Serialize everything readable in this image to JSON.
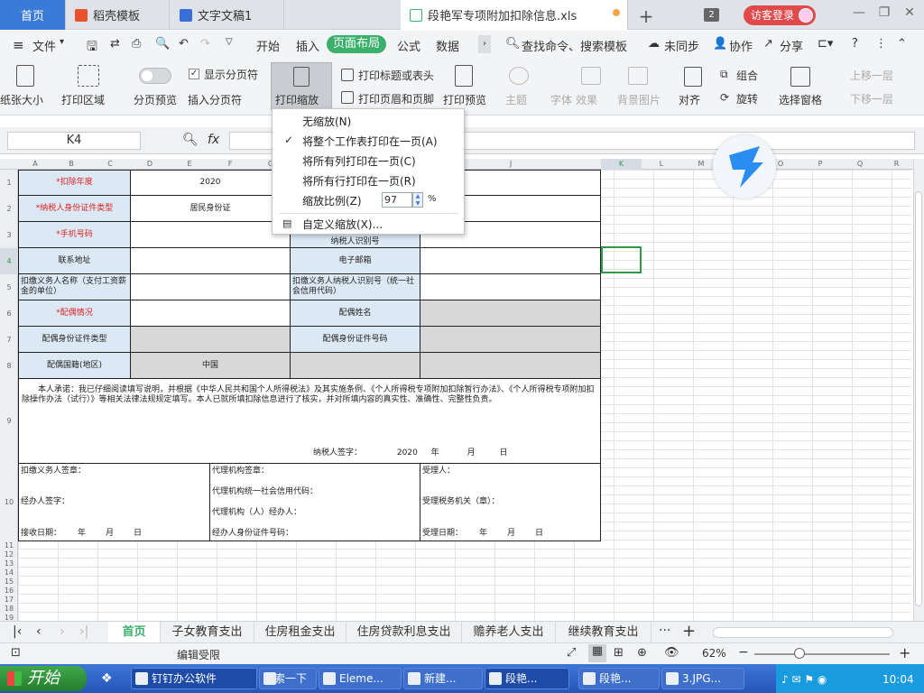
{
  "tabs": {
    "home": "首页",
    "t1": "稻壳模板",
    "t2": "文字文稿1",
    "t3": "段艳军专项附加扣除信息.xls",
    "count": "2",
    "login": "访客登录"
  },
  "menu": {
    "file": "文件",
    "items": [
      "开始",
      "插入",
      "页面布局",
      "公式",
      "数据"
    ],
    "search": "查找命令、搜索模板",
    "unsync": "未同步",
    "collab": "协作",
    "share": "分享"
  },
  "ribbon": {
    "paper_size": "纸张大小",
    "print_area": "打印区域",
    "show_pagebreak": "显示分页符",
    "pagebreak_preview": "分页预览",
    "insert_pagebreak": "插入分页符",
    "print_scale": "打印缩放",
    "print_titles": "打印标题或表头",
    "print_headerfooter": "打印页眉和页脚",
    "print_preview": "打印预览",
    "theme": "主题",
    "font": "字体",
    "effects": "效果",
    "background": "背景图片",
    "align": "对齐",
    "group": "组合",
    "rotate": "旋转",
    "select_pane": "选择窗格",
    "bring_forward": "上移一层",
    "send_backward": "下移一层"
  },
  "formula": {
    "cell_ref": "K4",
    "fx": "fx"
  },
  "dropdown": {
    "no_scale": "无缩放(N)",
    "fit_sheet": "将整个工作表打印在一页(A)",
    "fit_cols": "将所有列打印在一页(C)",
    "fit_rows": "将所有行打印在一页(R)",
    "scale_label": "缩放比例(Z)",
    "scale_value": "97",
    "percent": "%",
    "custom": "自定义缩放(X)..."
  },
  "columns": [
    "A",
    "B",
    "C",
    "D",
    "E",
    "F",
    "G",
    "H",
    "I",
    "J",
    "K",
    "L",
    "M",
    "N",
    "O",
    "P",
    "Q",
    "R"
  ],
  "rows": [
    "1",
    "2",
    "3",
    "4",
    "5",
    "6",
    "7",
    "8",
    "9",
    "10",
    "11",
    "12",
    "13",
    "14",
    "15",
    "16",
    "17",
    "18",
    "19",
    "20",
    "21"
  ],
  "sheet": {
    "deduct_year_label": "*扣除年度",
    "deduct_year": "2020",
    "id_type_label": "*纳税人身份证件类型",
    "id_type": "居民身份证",
    "phone_label": "*手机号码",
    "taxid_label": "纳税人识别号",
    "address_label": "联系地址",
    "email_label": "电子邮箱",
    "withholder_name": "扣缴义务人名称（支付工资薪金的单位）",
    "withholder_id": "扣缴义务人纳税人识别号（统一社会信用代码）",
    "spouse_status": "*配偶情况",
    "spouse_name": "配偶姓名",
    "spouse_idtype": "配偶身份证件类型",
    "spouse_idno": "配偶身份证件号码",
    "spouse_nation": "配偶国籍(地区)",
    "nation": "中国",
    "declaration": "本人承诺：我已仔细阅读填写说明，并根据《中华人民共和国个人所得税法》及其实施条例、《个人所得税专项附加扣除暂行办法》、《个人所得税专项附加扣除操作办法（试行）》等相关法律法规规定填写。本人已就所填扣除信息进行了核实，并对所填内容的真实性、准确性、完整性负责。",
    "sign": "纳税人签字：",
    "sign_year": "2020",
    "year": "年",
    "month": "月",
    "day": "日",
    "withholder_seal": "扣缴义务人签章：",
    "handler_sign": "经办人签字：",
    "receive_date": "接收日期：",
    "agent_seal": "代理机构签章：",
    "agent_code": "代理机构统一社会信用代码：",
    "agent_handler": "代理机构（人）经办人：",
    "handler_idno": "经办人身份证件号码：",
    "receiver": "受理人：",
    "tax_office": "受理税务机关（章）：",
    "accept_date": "受理日期："
  },
  "sheets": [
    "首页",
    "子女教育支出",
    "住房租金支出",
    "住房贷款利息支出",
    "赡养老人支出",
    "继续教育支出"
  ],
  "status": {
    "edit_limited": "编辑受限",
    "zoom": "62%"
  },
  "taskbar": {
    "start": "开始",
    "items": [
      "钉钉办公软件",
      "搜索一下",
      "Eleme...",
      "新建...",
      "段艳...",
      "段艳...",
      "3.JPG..."
    ],
    "clock": "10:04"
  },
  "colors": {
    "accent_green": "#3bb06c",
    "home_tab_blue": "#3b7bd8",
    "label_blue": "#dce9f5",
    "required_red": "#d22"
  }
}
